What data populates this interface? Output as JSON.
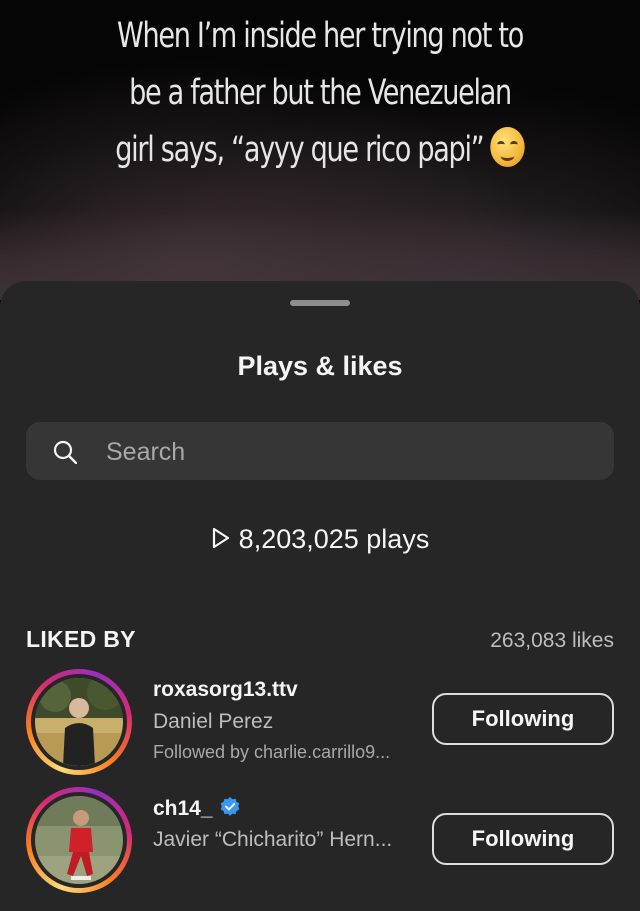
{
  "video": {
    "caption_line1": "When I’m inside her trying not to",
    "caption_line2": "be a father but the Venezuelan",
    "caption_line3": "girl says, “ayyy que rico papi”",
    "caption_emoji": "drooling-face-emoji"
  },
  "sheet": {
    "title": "Plays & likes",
    "search": {
      "placeholder": "Search",
      "icon": "search-icon"
    },
    "plays": {
      "icon": "play-icon",
      "text": "8,203,025 plays"
    },
    "liked_by": {
      "label": "LIKED BY",
      "likes_count": "263,083 likes"
    },
    "users": [
      {
        "username": "roxasorg13.ttv",
        "full_name": "Daniel Perez",
        "followed_by": "Followed by charlie.carrillo9...",
        "button": "Following",
        "verified": false
      },
      {
        "username": "ch14_",
        "full_name": "Javier “Chicharito” Hern...",
        "button": "Following",
        "verified": true
      }
    ]
  },
  "colors": {
    "sheet_bg": "#262626",
    "search_bg": "#363636",
    "verified_blue": "#3897f0",
    "story_ring": [
      "#feda75",
      "#fa7e1e",
      "#d62976",
      "#962fbf"
    ]
  }
}
